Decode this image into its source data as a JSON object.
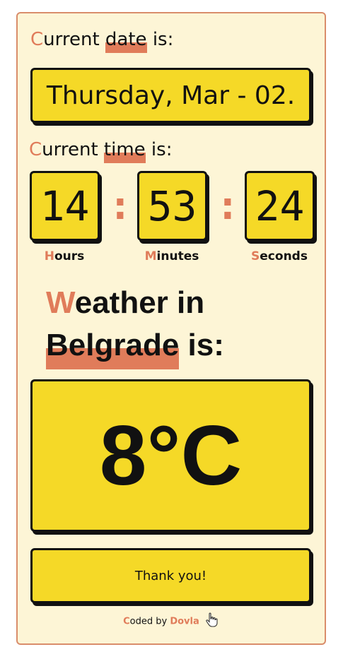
{
  "date_section": {
    "label_first": "C",
    "label_pre": "urrent ",
    "label_hl": "date",
    "label_post": " is:",
    "value": "Thursday, Mar - 02."
  },
  "time_section": {
    "label_first": "C",
    "label_pre": "urrent ",
    "label_hl": "time",
    "label_post": " is:"
  },
  "clock": {
    "hours": "14",
    "minutes": "53",
    "seconds": "24",
    "separator": ":",
    "hours_first": "H",
    "hours_rest": "ours",
    "minutes_first": "M",
    "minutes_rest": "inutes",
    "seconds_first": "S",
    "seconds_rest": "econds"
  },
  "weather": {
    "title_first": "W",
    "title_rest": "eather in",
    "city": "Belgrade",
    "title_end": " is:",
    "temperature": "8°C"
  },
  "thanks_button": {
    "label": "Thank you!"
  },
  "footer": {
    "first": "C",
    "text": "oded by ",
    "author": "Dovla"
  },
  "colors": {
    "accent": "#e07c5a",
    "box": "#f5d927",
    "card_bg": "#fdf5d6",
    "border": "#d98d6b"
  },
  "icons": {
    "cursor": "hand-pointer-icon"
  }
}
